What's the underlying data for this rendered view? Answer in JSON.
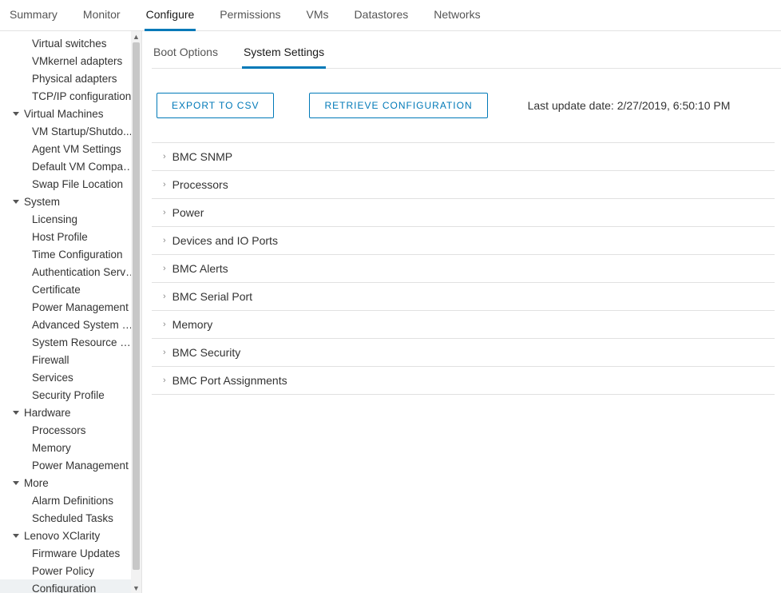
{
  "top_tabs": [
    {
      "label": "Summary"
    },
    {
      "label": "Monitor"
    },
    {
      "label": "Configure",
      "active": true
    },
    {
      "label": "Permissions"
    },
    {
      "label": "VMs"
    },
    {
      "label": "Datastores"
    },
    {
      "label": "Networks"
    }
  ],
  "sidebar": {
    "items": [
      {
        "type": "item",
        "label": "Virtual switches"
      },
      {
        "type": "item",
        "label": "VMkernel adapters"
      },
      {
        "type": "item",
        "label": "Physical adapters"
      },
      {
        "type": "item",
        "label": "TCP/IP configuration"
      },
      {
        "type": "group",
        "label": "Virtual Machines"
      },
      {
        "type": "item",
        "label": "VM Startup/Shutdo..."
      },
      {
        "type": "item",
        "label": "Agent VM Settings"
      },
      {
        "type": "item",
        "label": "Default VM Compati..."
      },
      {
        "type": "item",
        "label": "Swap File Location"
      },
      {
        "type": "group",
        "label": "System"
      },
      {
        "type": "item",
        "label": "Licensing"
      },
      {
        "type": "item",
        "label": "Host Profile"
      },
      {
        "type": "item",
        "label": "Time Configuration"
      },
      {
        "type": "item",
        "label": "Authentication Servi..."
      },
      {
        "type": "item",
        "label": "Certificate"
      },
      {
        "type": "item",
        "label": "Power Management"
      },
      {
        "type": "item",
        "label": "Advanced System S..."
      },
      {
        "type": "item",
        "label": "System Resource Re..."
      },
      {
        "type": "item",
        "label": "Firewall"
      },
      {
        "type": "item",
        "label": "Services"
      },
      {
        "type": "item",
        "label": "Security Profile"
      },
      {
        "type": "group",
        "label": "Hardware"
      },
      {
        "type": "item",
        "label": "Processors"
      },
      {
        "type": "item",
        "label": "Memory"
      },
      {
        "type": "item",
        "label": "Power Management"
      },
      {
        "type": "group",
        "label": "More"
      },
      {
        "type": "item",
        "label": "Alarm Definitions"
      },
      {
        "type": "item",
        "label": "Scheduled Tasks"
      },
      {
        "type": "group",
        "label": "Lenovo XClarity"
      },
      {
        "type": "item",
        "label": "Firmware Updates"
      },
      {
        "type": "item",
        "label": "Power Policy"
      },
      {
        "type": "item",
        "label": "Configuration",
        "selected": true
      }
    ]
  },
  "sub_tabs": [
    {
      "label": "Boot Options"
    },
    {
      "label": "System Settings",
      "active": true
    }
  ],
  "toolbar": {
    "export_label": "EXPORT TO CSV",
    "retrieve_label": "RETRIEVE CONFIGURATION",
    "last_update_prefix": "Last update date: ",
    "last_update_value": "2/27/2019, 6:50:10 PM"
  },
  "accordion": [
    {
      "label": "BMC SNMP"
    },
    {
      "label": "Processors"
    },
    {
      "label": "Power"
    },
    {
      "label": "Devices and IO Ports"
    },
    {
      "label": "BMC Alerts"
    },
    {
      "label": "BMC Serial Port"
    },
    {
      "label": "Memory"
    },
    {
      "label": "BMC Security"
    },
    {
      "label": "BMC Port Assignments"
    }
  ]
}
